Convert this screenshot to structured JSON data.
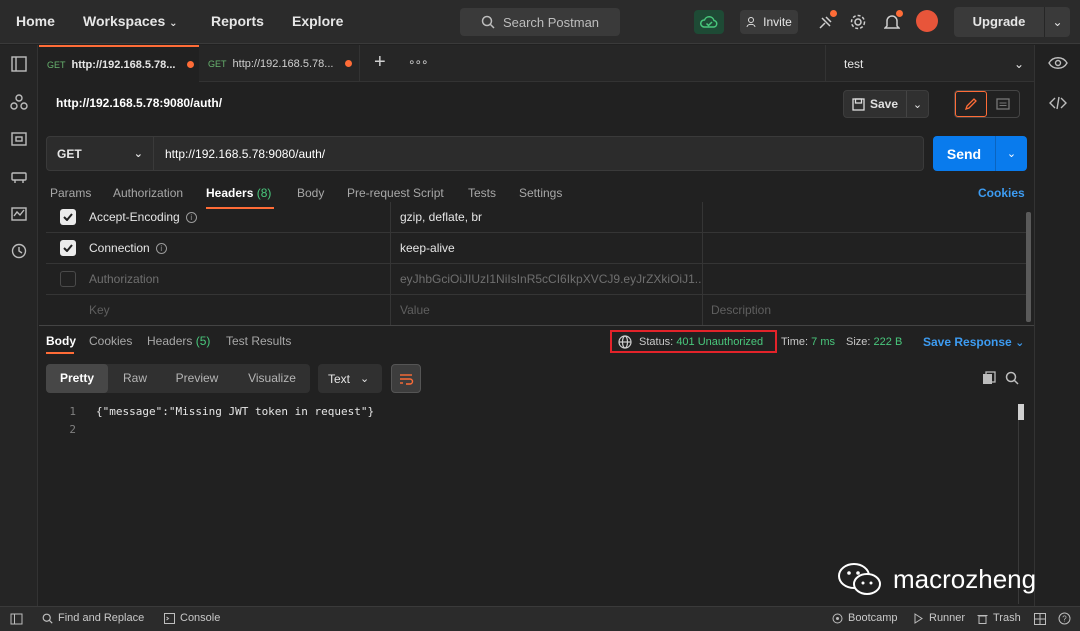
{
  "topbar": {
    "nav": [
      "Home",
      "Workspaces",
      "Reports",
      "Explore"
    ],
    "search_placeholder": "Search Postman",
    "invite_label": "Invite",
    "upgrade_label": "Upgrade"
  },
  "tabs": [
    {
      "method": "GET",
      "title": "http://192.168.5.78..."
    },
    {
      "method": "GET",
      "title": "http://192.168.5.78..."
    }
  ],
  "environment": {
    "selected": "test"
  },
  "request": {
    "title": "http://192.168.5.78:9080/auth/",
    "save_label": "Save",
    "method": "GET",
    "url": "http://192.168.5.78:9080/auth/",
    "send_label": "Send",
    "subtabs": [
      "Params",
      "Authorization",
      "Headers",
      "Body",
      "Pre-request Script",
      "Tests",
      "Settings"
    ],
    "headers_count": "(8)",
    "cookies_label": "Cookies"
  },
  "headers_table": {
    "rows": [
      {
        "key": "Accept-Encoding",
        "value": "gzip, deflate, br",
        "checked": true
      },
      {
        "key": "Connection",
        "value": "keep-alive",
        "checked": true
      },
      {
        "key": "Authorization",
        "value": "eyJhbGciOiJIUzI1NiIsInR5cCI6IkpXVCJ9.eyJrZXkiOiJ1...",
        "checked": false
      }
    ],
    "placeholders": {
      "key": "Key",
      "value": "Value",
      "description": "Description"
    }
  },
  "response": {
    "tabs": [
      "Body",
      "Cookies",
      "Headers",
      "Test Results"
    ],
    "headers_count": "(5)",
    "status_label": "Status:",
    "status_value": "401 Unauthorized",
    "time_label": "Time:",
    "time_value": "7 ms",
    "size_label": "Size:",
    "size_value": "222 B",
    "save_response_label": "Save Response",
    "view_modes": [
      "Pretty",
      "Raw",
      "Preview",
      "Visualize"
    ],
    "format": "Text",
    "lines": [
      {
        "num": "1",
        "text": "{\"message\":\"Missing JWT token in request\"}"
      },
      {
        "num": "2",
        "text": ""
      }
    ]
  },
  "watermark": "macrozheng",
  "footer": {
    "find_replace": "Find and Replace",
    "console": "Console",
    "bootcamp": "Bootcamp",
    "runner": "Runner",
    "trash": "Trash"
  },
  "colors": {
    "accent": "#ff6c37",
    "send": "#097bed",
    "status_ok_text": "#49c77c",
    "highlight_box": "#e3232a"
  }
}
